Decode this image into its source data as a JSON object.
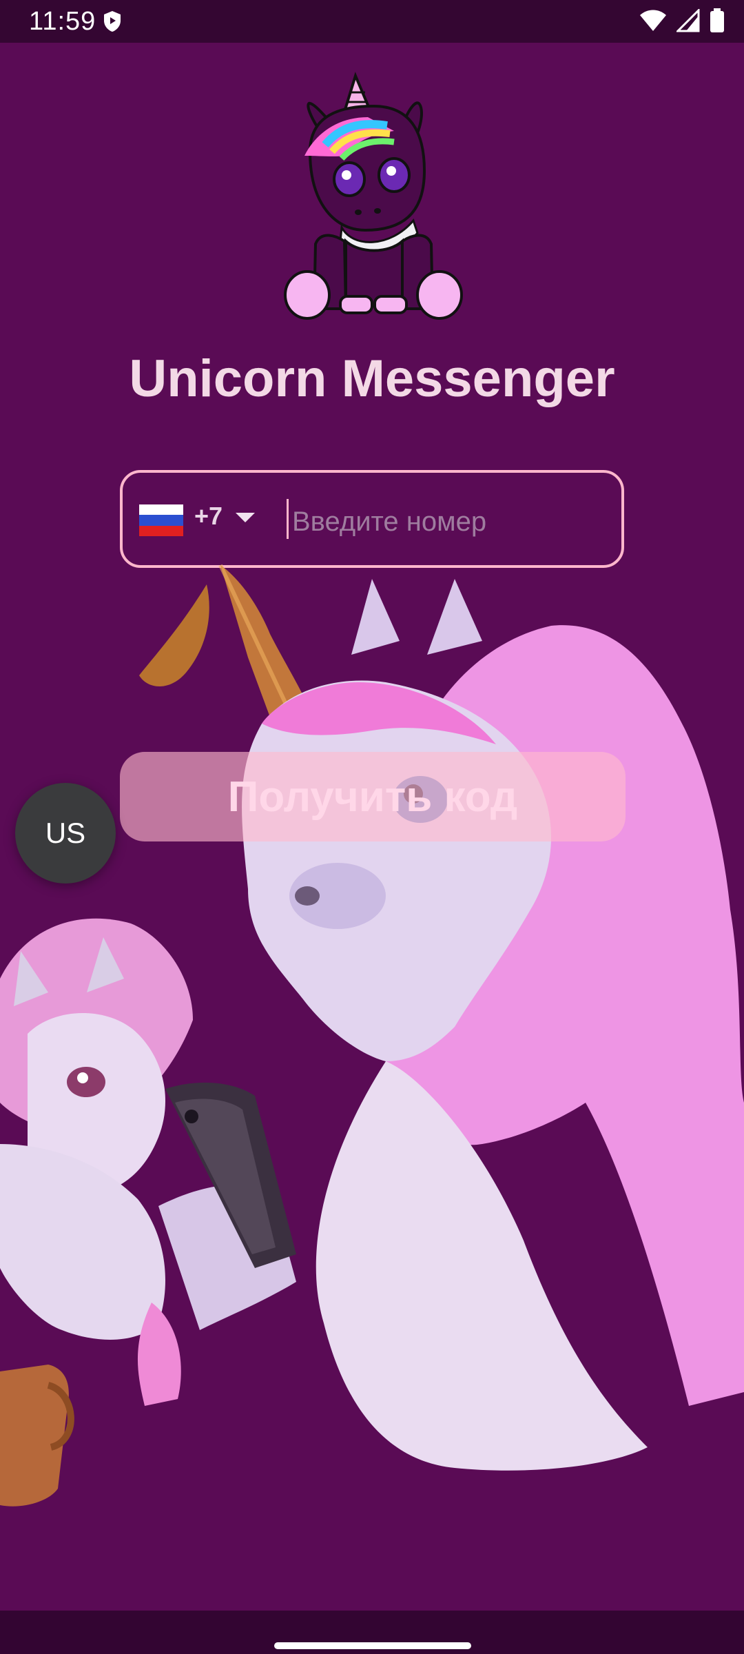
{
  "status_bar": {
    "time": "11:59",
    "icons": [
      "shield-icon",
      "wifi-icon",
      "signal-icon",
      "battery-icon"
    ]
  },
  "app": {
    "title": "Unicorn Messenger"
  },
  "phone": {
    "country_flag": "russia-flag-icon",
    "country_code": "+7",
    "placeholder": "Введите номер",
    "value": ""
  },
  "actions": {
    "get_code_label": "Получить код",
    "language_label": "US"
  },
  "colors": {
    "background": "#5a0b55",
    "accent_border": "#ffb7cc",
    "button_bg": "#ffb9cd",
    "status_bar": "#340632",
    "lang_fab": "#3a3b3d"
  }
}
